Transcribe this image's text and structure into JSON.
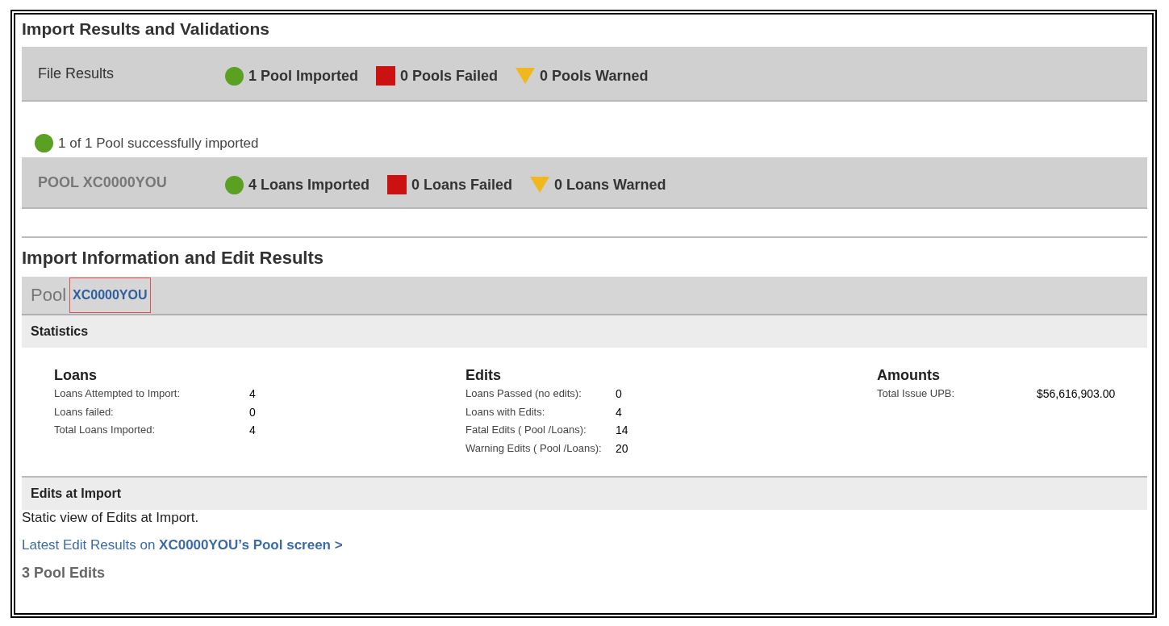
{
  "title": "Import Results and Validations",
  "file_results": {
    "label": "File Results",
    "items": [
      {
        "kind": "success",
        "text": "1 Pool Imported"
      },
      {
        "kind": "failed",
        "text": "0 Pools Failed"
      },
      {
        "kind": "warned",
        "text": "0 Pools Warned"
      }
    ]
  },
  "pool_summary": {
    "kind": "success",
    "text": "1 of 1 Pool successfully imported"
  },
  "pool_results": {
    "label": "POOL XC0000YOU",
    "items": [
      {
        "kind": "success",
        "text": "4 Loans Imported"
      },
      {
        "kind": "failed",
        "text": "0 Loans Failed"
      },
      {
        "kind": "warned",
        "text": "0 Loans Warned"
      }
    ]
  },
  "info_title": "Import Information and Edit Results",
  "pool_header": {
    "label": "Pool",
    "link": "XC0000YOU",
    "highlighted": true
  },
  "statistics": {
    "title": "Statistics",
    "groups": [
      {
        "title": "Loans",
        "rows": [
          {
            "label": "Loans Attempted to Import:",
            "value": "4"
          },
          {
            "label": "Loans failed:",
            "value": "0"
          },
          {
            "label": "Total Loans Imported:",
            "value": "4"
          }
        ]
      },
      {
        "title": "Edits",
        "rows": [
          {
            "label": "Loans Passed (no edits):",
            "value": "0"
          },
          {
            "label": "Loans with Edits:",
            "value": "4"
          },
          {
            "label": "Fatal Edits ( Pool /Loans):",
            "value": "14"
          },
          {
            "label": "Warning Edits ( Pool /Loans):",
            "value": "20"
          }
        ]
      },
      {
        "title": "Amounts",
        "rows": [
          {
            "label": "Total Issue UPB:",
            "value": "$56,616,903.00"
          }
        ]
      }
    ]
  },
  "edits_at_import": {
    "title": "Edits at Import",
    "description": "Static view of Edits at Import.",
    "link": "Latest Edit Results on **XC0000YOU’s Pool screen >**",
    "count": "3 Pool Edits"
  }
}
